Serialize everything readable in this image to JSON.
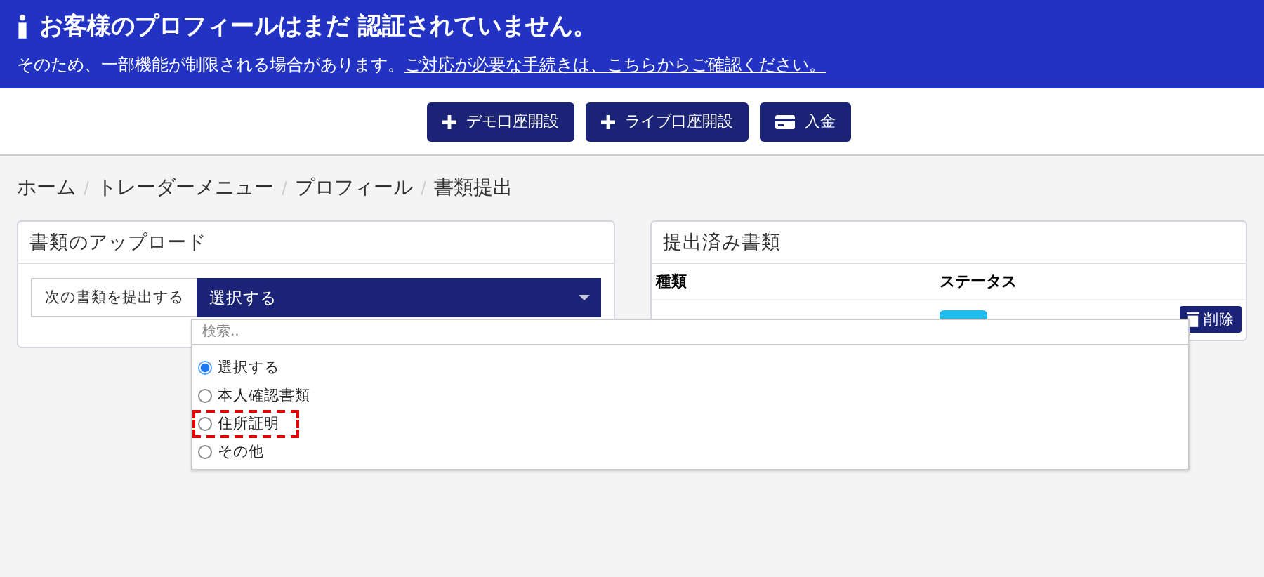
{
  "banner": {
    "title": "お客様のプロフィールはまだ 認証されていません。",
    "message": "そのため、一部機能が制限される場合があります。",
    "link": "ご対応が必要な手続きは、こちらからご確認ください。"
  },
  "actions": [
    {
      "kind": "plus",
      "label": "デモ口座開設"
    },
    {
      "kind": "plus",
      "label": "ライブ口座開設"
    },
    {
      "kind": "card",
      "label": "入金"
    }
  ],
  "breadcrumb": [
    "ホーム",
    "トレーダーメニュー",
    "プロフィール",
    "書類提出"
  ],
  "upload": {
    "title": "書類のアップロード",
    "field_label": "次の書類を提出する",
    "select_value": "選択する",
    "dropdown": {
      "placeholder": "検索..",
      "options": [
        {
          "label": "選択する",
          "selected": true,
          "highlighted": false
        },
        {
          "label": "本人確認書類",
          "selected": false,
          "highlighted": false
        },
        {
          "label": "住所証明",
          "selected": false,
          "highlighted": true
        },
        {
          "label": "その他",
          "selected": false,
          "highlighted": false
        }
      ]
    }
  },
  "submitted": {
    "title": "提出済み書類",
    "columns": [
      "種類",
      "ステータス"
    ],
    "rows": [
      {
        "delete": "削除"
      }
    ]
  }
}
